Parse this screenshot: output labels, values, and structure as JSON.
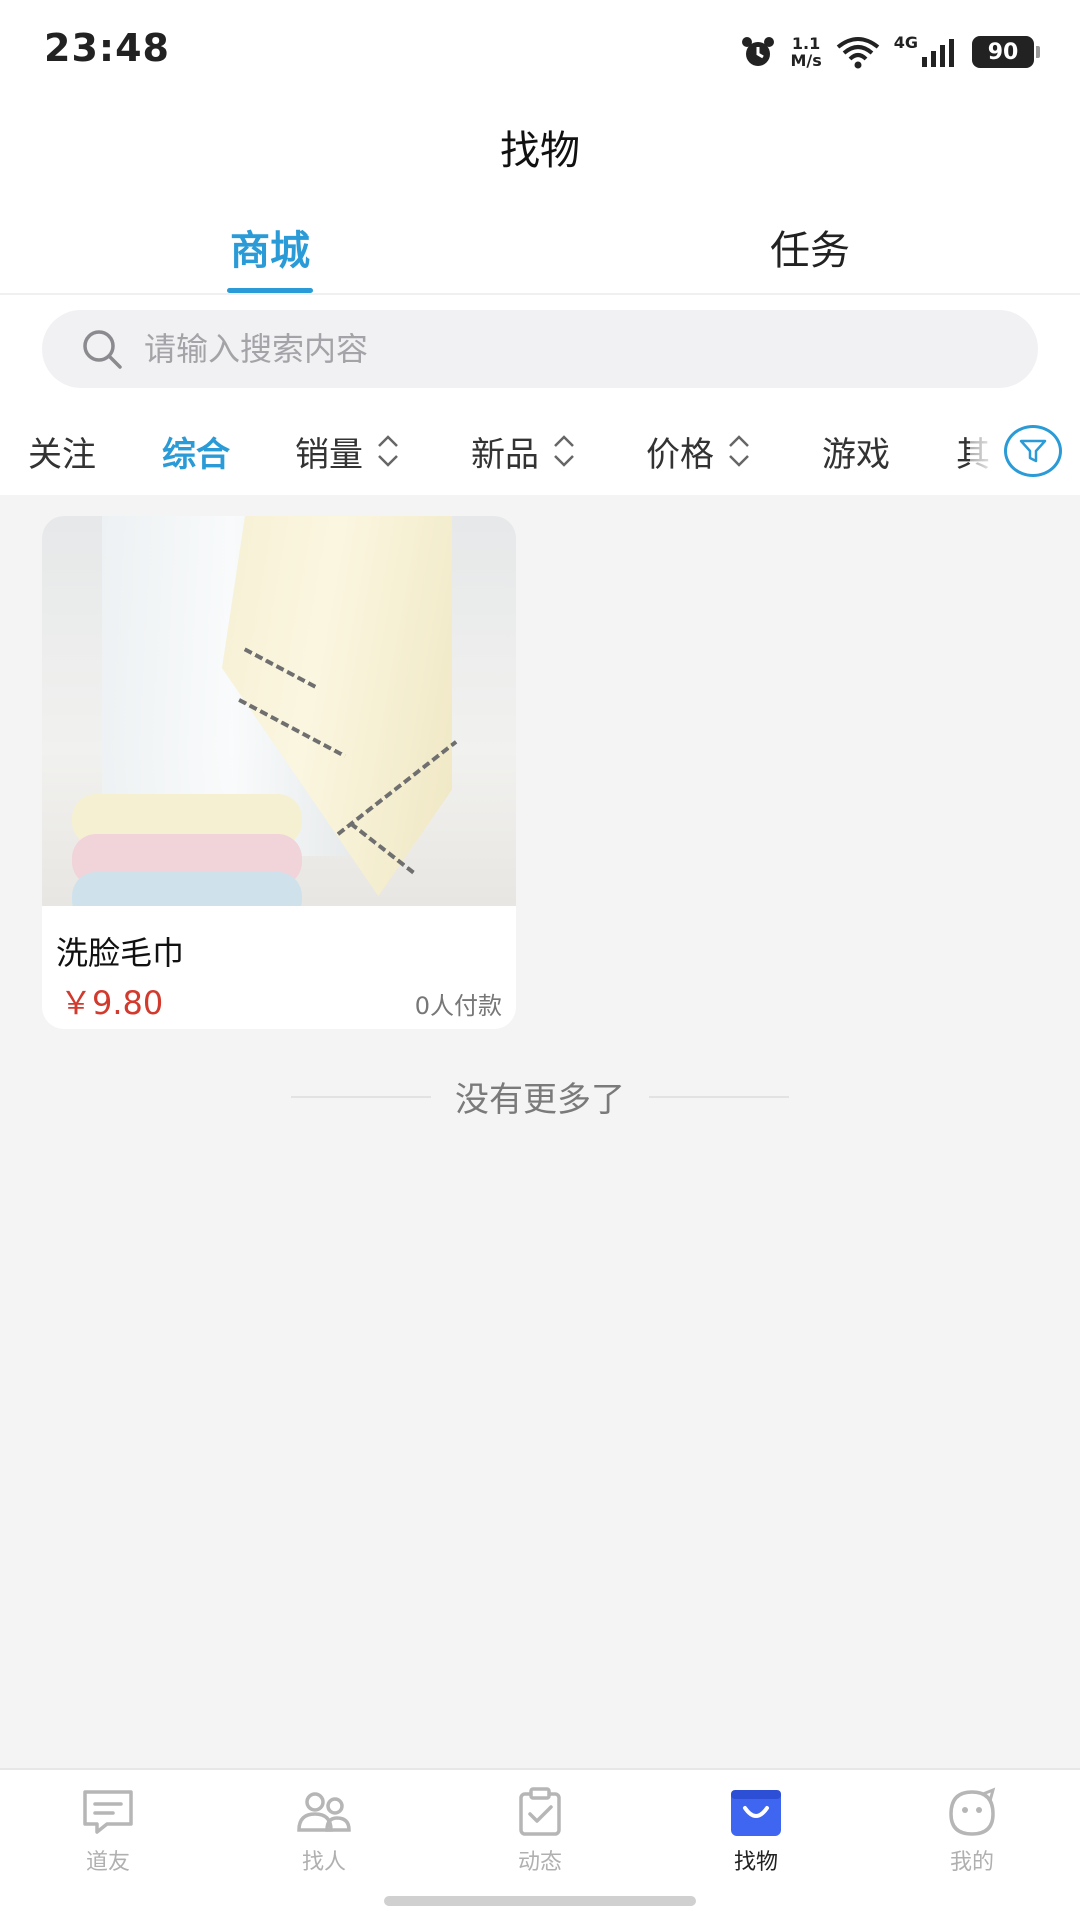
{
  "status_bar": {
    "time": "23:48",
    "net_speed_value": "1.1",
    "net_speed_unit": "M/s",
    "network": "4G",
    "battery": "90",
    "icons": [
      "alarm-icon",
      "wifi-icon",
      "signal-icon",
      "battery-icon"
    ]
  },
  "header": {
    "title": "找物",
    "tabs": [
      {
        "label": "商城",
        "active": true
      },
      {
        "label": "任务",
        "active": false
      }
    ]
  },
  "search": {
    "placeholder": "请输入搜索内容"
  },
  "filters": {
    "items": [
      {
        "label": "关注"
      },
      {
        "label": "综合"
      },
      {
        "label": "销量"
      },
      {
        "label": "新品"
      },
      {
        "label": "价格"
      },
      {
        "label": "游戏"
      },
      {
        "label": "其"
      }
    ],
    "active": "综合"
  },
  "products": [
    {
      "name": "洗脸毛巾",
      "price": "￥9.80",
      "sales": "0人付款"
    }
  ],
  "list_end_text": "没有更多了",
  "bottom_nav": {
    "items": [
      {
        "label": "道友",
        "icon": "chat-icon"
      },
      {
        "label": "找人",
        "icon": "people-icon"
      },
      {
        "label": "动态",
        "icon": "clipboard-icon"
      },
      {
        "label": "找物",
        "icon": "shopping-bag-icon"
      },
      {
        "label": "我的",
        "icon": "face-icon"
      }
    ],
    "active": "找物"
  },
  "colors": {
    "accent": "#2a9bd6",
    "price": "#d23a2e",
    "nav_active": "#3f66f0"
  }
}
